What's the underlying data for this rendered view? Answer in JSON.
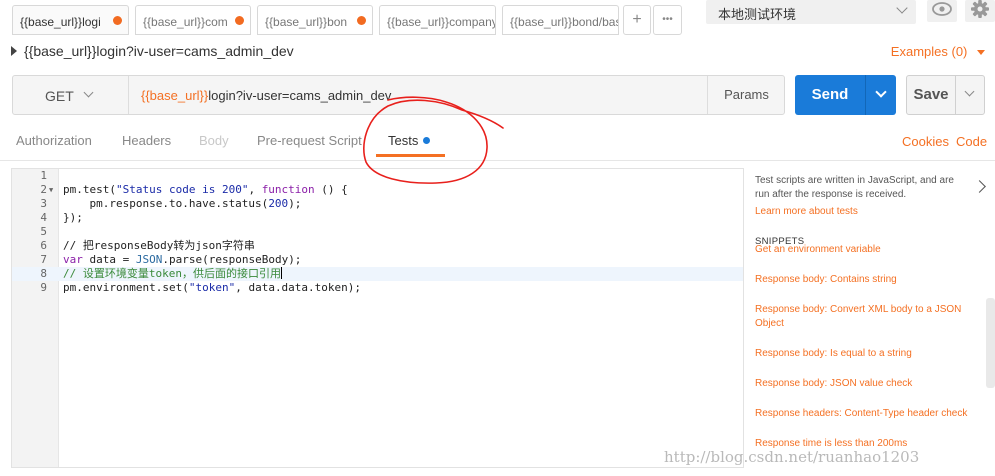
{
  "tabs": [
    {
      "label": "{{base_url}}logi",
      "unsaved": true,
      "active": true
    },
    {
      "label": "{{base_url}}com",
      "unsaved": true,
      "active": false
    },
    {
      "label": "{{base_url}}bon",
      "unsaved": true,
      "active": false
    },
    {
      "label": "{{base_url}}company",
      "unsaved": false,
      "active": false
    },
    {
      "label": "{{base_url}}bond/bas",
      "unsaved": false,
      "active": false
    }
  ],
  "tab_actions": {
    "add": "+",
    "more": "•••"
  },
  "environment": {
    "selected": "本地测试环境"
  },
  "request": {
    "name": "{{base_url}}login?iv-user=cams_admin_dev",
    "examples_label": "Examples (0)",
    "method": "GET",
    "url_var": "{{base_url}}",
    "url_rest": "login?iv-user=cams_admin_dev",
    "params_label": "Params",
    "send_label": "Send",
    "save_label": "Save"
  },
  "subtabs": [
    {
      "label": "Authorization",
      "state": "normal"
    },
    {
      "label": "Headers",
      "state": "normal"
    },
    {
      "label": "Body",
      "state": "disabled"
    },
    {
      "label": "Pre-request Script",
      "state": "normal"
    },
    {
      "label": "Tests",
      "state": "active"
    }
  ],
  "links": {
    "cookies": "Cookies",
    "code": "Code"
  },
  "editor": {
    "line_numbers": [
      "1",
      "2",
      "3",
      "4",
      "5",
      "6",
      "7",
      "8",
      "9"
    ],
    "lines": [
      "",
      "pm.test(\"Status code is 200\", function () {",
      "    pm.response.to.have.status(200);",
      "});",
      "",
      "// 把responseBody转为json字符串",
      "var data = JSON.parse(responseBody);",
      "// 设置环境变量token，供后面的接口引用",
      "pm.environment.set(\"token\", data.data.token);"
    ],
    "highlighted_line": 8
  },
  "sidebar": {
    "description": "Test scripts are written in JavaScript, and are run after the response is received.",
    "learn_more": "Learn more about tests",
    "snippets_heading": "SNIPPETS",
    "snippets": [
      "Get an environment variable",
      "Response body: Contains string",
      "Response body: Convert XML body to a JSON Object",
      "Response body: Is equal to a string",
      "Response body: JSON value check",
      "Response headers: Content-Type header check",
      "Response time is less than 200ms"
    ]
  },
  "watermark": "http://blog.csdn.net/ruanhao1203",
  "colors": {
    "accent": "#f47023",
    "send": "#1a7bd9",
    "annotation": "#e8201c"
  }
}
